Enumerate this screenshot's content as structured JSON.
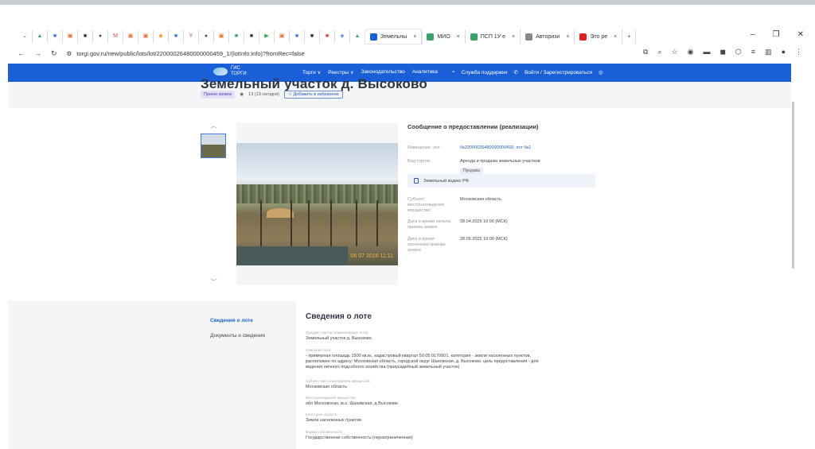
{
  "browser": {
    "mini_tabs": [
      {
        "icon": "chevron-down-icon",
        "color": "#555"
      },
      {
        "icon": "triangle-icon",
        "color": "#3aa36a"
      },
      {
        "icon": "square-icon",
        "color": "#3b78e7"
      },
      {
        "icon": "bag-icon",
        "color": "#e86c2c"
      },
      {
        "icon": "square-icon",
        "color": "#333"
      },
      {
        "icon": "circle-icon",
        "color": "#555"
      },
      {
        "icon": "m-icon",
        "color": "#d84a3a"
      },
      {
        "icon": "bag-icon",
        "color": "#e86c2c"
      },
      {
        "icon": "bag-icon",
        "color": "#e86c2c"
      },
      {
        "icon": "pin-icon",
        "color": "#f0a030"
      },
      {
        "icon": "square-icon",
        "color": "#3b78e7"
      },
      {
        "icon": "y-icon",
        "color": "#d84a3a"
      },
      {
        "icon": "circle-icon",
        "color": "#555"
      },
      {
        "icon": "bag-icon",
        "color": "#e86c2c"
      },
      {
        "icon": "square-icon",
        "color": "#3aa36a"
      },
      {
        "icon": "square-icon",
        "color": "#333"
      },
      {
        "icon": "play-icon",
        "color": "#2aa84a"
      },
      {
        "icon": "bag-icon",
        "color": "#e86c2c"
      },
      {
        "icon": "square-icon",
        "color": "#3b78e7"
      },
      {
        "icon": "square-icon",
        "color": "#333"
      },
      {
        "icon": "square-icon",
        "color": "#d84a3a"
      },
      {
        "icon": "shield-icon",
        "color": "#3b78e7"
      },
      {
        "icon": "triangle-icon",
        "color": "#3aa36a"
      }
    ],
    "tabs": [
      {
        "label": "Земельны",
        "icon_color": "#1a5fd8",
        "active": true
      },
      {
        "label": "МИО",
        "icon_color": "#3aa36a",
        "active": false
      },
      {
        "label": "ПСП 1У е",
        "icon_color": "#3aa36a",
        "active": false
      },
      {
        "label": "Авторизи",
        "icon_color": "#888",
        "active": false
      },
      {
        "label": "Это ре",
        "icon_color": "#e02020",
        "active": false
      }
    ],
    "url": "torgi.gov.ru/new/public/lots/lot/22000026480000000459_1/(lotInfo:info)?fromRec=false"
  },
  "site": {
    "logo_line1": "ГИС",
    "logo_line2": "ТОРГИ",
    "nav": [
      "Торги ∨",
      "Реестры ∨",
      "Законодательство",
      "Аналитика"
    ],
    "support": "Служба поддержки",
    "login": "Войти / Зарегистрироваться"
  },
  "lot": {
    "title": "Земельный участок д. Высоково",
    "status": "Прием заявок",
    "views": "13 (13 сегодня)",
    "favorite": "Добавить в избранное",
    "photo_stamp": "06 07 2016 11:11"
  },
  "info": {
    "heading": "Сообщение о предоставлении (реализации)",
    "rows": [
      {
        "key": "Извещение, лот",
        "value": "№22000026480000000459, лот №1"
      },
      {
        "key": "Вид торгов",
        "value": "Аренда и продажа земельных участков"
      },
      {
        "key": "Субъект местонахождения имущества",
        "value": "Московская область"
      },
      {
        "key": "Дата и время начала приема заявок",
        "value": "28.04.2025 10:00 (МСК)"
      },
      {
        "key": "Дата и время окончания приема заявок",
        "value": "28.05.2025 10:00 (МСК)"
      }
    ],
    "sale_badge": "Продажа",
    "code": "Земельный кодекс РФ"
  },
  "sidebar": {
    "items": [
      "Сведения о лоте",
      "Документы и сведения"
    ]
  },
  "details": {
    "heading": "Сведения о лоте",
    "fields": [
      {
        "label": "Предмет торгов (наименование лота)",
        "value": "Земельный участок д. Высоково"
      },
      {
        "label": "Описание лота",
        "value": "- примерная площадь 1500 кв.м., кадастровый квартал 50:05:0170601, категория - земли населенных пунктов, расположен по адресу: Московская область, городской округ Шаховская, д. Высоково, цель предоставления - для ведения личного подсобного хозяйства (приусадебный земельный участок)"
      },
      {
        "label": "Субъект местонахождения имущества",
        "value": "Московская область"
      },
      {
        "label": "Местонахождение имущества",
        "value": "обл Московская, м.о. Шаховская, д Высоково"
      },
      {
        "label": "Категория объекта",
        "value": "Земли населенных пунктов"
      },
      {
        "label": "Форма собственности",
        "value": "Государственная собственность (неразграниченная)"
      }
    ]
  }
}
